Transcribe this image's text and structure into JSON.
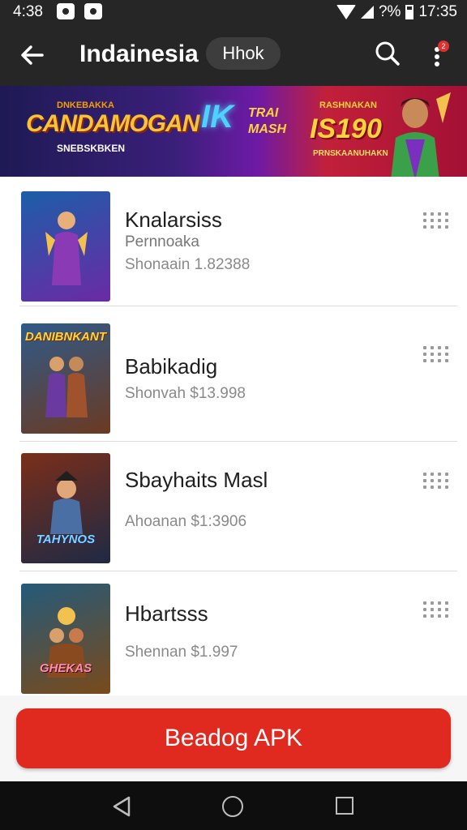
{
  "status_bar": {
    "time": "4:38",
    "battery": "?%",
    "clock": "17:35",
    "icons": [
      "notification-icon",
      "notification-icon",
      "wifi-icon",
      "signal-icon",
      "battery-icon"
    ]
  },
  "app_bar": {
    "title": "Indainesia",
    "chip_label": "Hhok",
    "icons": [
      "back-arrow-icon",
      "search-icon",
      "more-vert-icon"
    ],
    "badge_color": "#e03131"
  },
  "banner": {
    "left_small": "DNKEBAKKA",
    "left_title": "CANDAMOGAN",
    "left_sub": "SNEBSKBKEN",
    "mid_big": "IK",
    "mid_small": "TRAI MASH",
    "right_small": "RASHNAKAN",
    "right_price": "IS190",
    "right_sub": "PRNSKAANUHAKN"
  },
  "items": [
    {
      "title": "Knalarsiss",
      "subtitle": "Pernnoaka",
      "meta": "Shonaain 1.82388",
      "thumb_caption": "",
      "thumb_colors": [
        "#1c5ea8",
        "#6b2aa5"
      ]
    },
    {
      "title": "Babikadig",
      "subtitle": "",
      "meta": "Shonvah $13.998",
      "thumb_caption": "DANIBNKANT",
      "thumb_colors": [
        "#2f5a8a",
        "#6b3a20"
      ]
    },
    {
      "title": "Sbayhaits Masl",
      "subtitle": "",
      "meta": "Ahoanan $1:3906",
      "thumb_caption": "TAHYNOS",
      "thumb_colors": [
        "#7a2e1a",
        "#1f2a44"
      ]
    },
    {
      "title": "Hbartsss",
      "subtitle": "",
      "meta": "Shennan $1.997",
      "thumb_caption": "GHEKAS",
      "thumb_colors": [
        "#245a7a",
        "#7a4a1a"
      ]
    }
  ],
  "cta": {
    "label": "Beadog APK",
    "color": "#e02a1f"
  },
  "nav": {
    "icons": [
      "nav-back-icon",
      "nav-home-icon",
      "nav-recent-icon"
    ]
  }
}
